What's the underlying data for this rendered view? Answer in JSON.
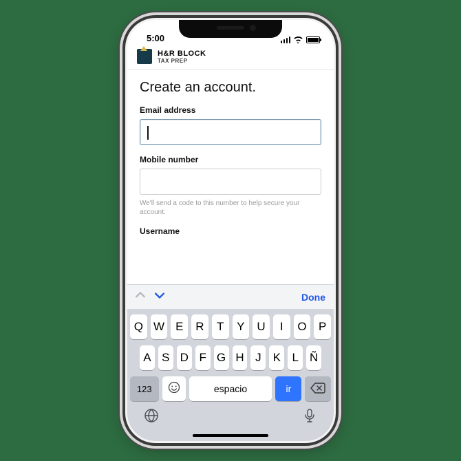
{
  "status": {
    "time": "5:00"
  },
  "app": {
    "title": "H&R BLOCK",
    "subtitle": "TAX PREP"
  },
  "page": {
    "title": "Create an account.",
    "fields": {
      "email": {
        "label": "Email address",
        "value": ""
      },
      "mobile": {
        "label": "Mobile number",
        "value": "",
        "hint": "We'll send a code to this number to help secure your account."
      },
      "username": {
        "label": "Username",
        "value": ""
      }
    }
  },
  "kb_accessory": {
    "done": "Done"
  },
  "keyboard": {
    "row1": [
      "Q",
      "W",
      "E",
      "R",
      "T",
      "Y",
      "U",
      "I",
      "O",
      "P"
    ],
    "row2": [
      "A",
      "S",
      "D",
      "F",
      "G",
      "H",
      "J",
      "K",
      "L",
      "Ñ"
    ],
    "num_key": "123",
    "space_key": "espacio",
    "go_key": "ir"
  }
}
